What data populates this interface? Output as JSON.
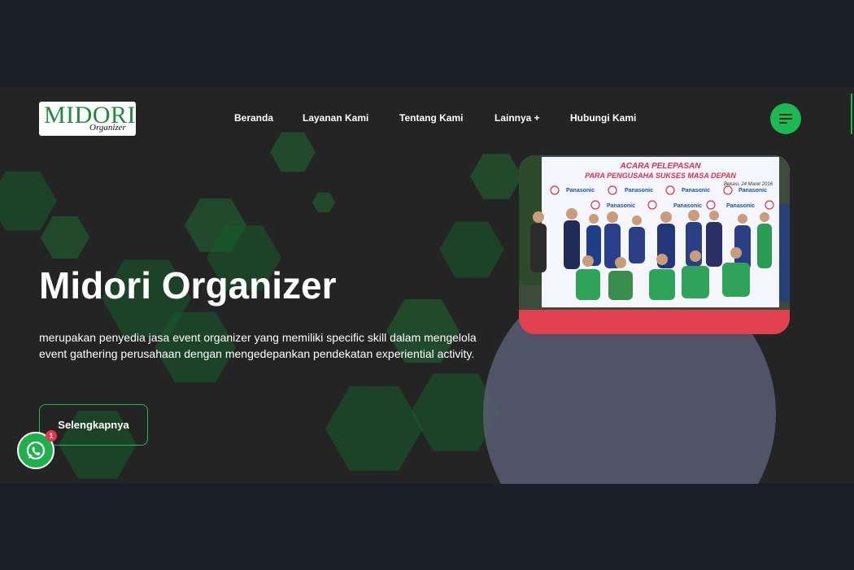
{
  "brand": {
    "logo_main": "MIDORI",
    "logo_sub": "Organizer"
  },
  "nav": {
    "items": [
      "Beranda",
      "Layanan Kami",
      "Tentang Kami",
      "Lainnya +",
      "Hubungi Kami"
    ]
  },
  "menu_icon": "hamburger-icon",
  "hero": {
    "title": "Midori Organizer",
    "description": "merupakan penyedia jasa event organizer yang memiliki specific skill dalam mengelola event gathering perusahaan dengan mengedepankan pendekatan experiential activity.",
    "cta_label": "Selengkapnya"
  },
  "photo": {
    "banner_line1": "ACARA PELEPASAN",
    "banner_line2": "PARA PENGUSAHA SUKSES MASA DEPAN",
    "banner_date": "Bekasi, 24 Maret 2016",
    "sponsor": "Panasonic"
  },
  "whatsapp": {
    "icon": "whatsapp-icon",
    "badge_count": "1"
  },
  "colors": {
    "page_bg": "#1a1f29",
    "hero_bg": "#242424",
    "accent": "#1db954",
    "hex_green": "#155d29",
    "circle": "#5c6077",
    "badge": "#e8334a"
  }
}
